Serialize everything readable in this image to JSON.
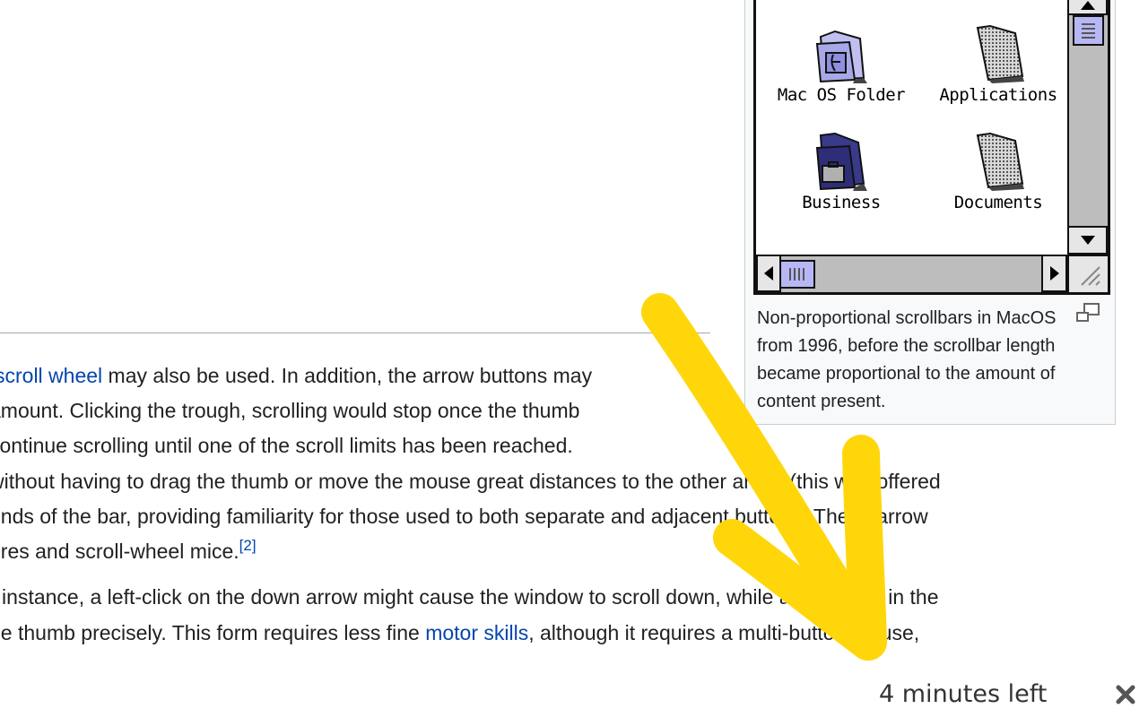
{
  "article": {
    "lines": [
      {
        "link": "scroll wheel",
        "text": " may also be used. In addition, the arrow buttons may"
      },
      {
        "text": "amount. Clicking the trough, scrolling would stop once the thumb"
      },
      {
        "text": "continue scrolling until one of the scroll limits has been reached."
      },
      {
        "text": "without having to drag the thumb or move the mouse great distances to the other arrow (this was offered"
      },
      {
        "text": "ends of the bar, providing familiarity for those used to both separate and adjacent buttons. These arrow"
      },
      {
        "text": "ures and scroll-wheel mice.",
        "sup": "[2]"
      },
      {
        "text": "r instance, a left-click on the down arrow might cause the window to scroll down, while a right click in the"
      },
      {
        "before": "he thumb precisely. This form requires less fine ",
        "link": "motor skills",
        "after": ", although it requires a multi-button mouse,"
      }
    ]
  },
  "thumbnail": {
    "icons": [
      {
        "label": "Mac OS Folder",
        "icon": "system-folder-icon"
      },
      {
        "label": "Applications",
        "icon": "folder-icon"
      },
      {
        "label": "Business",
        "icon": "business-folder-icon"
      },
      {
        "label": "Documents",
        "icon": "folder-icon"
      }
    ],
    "caption": "Non-proportional scrollbars in MacOS from 1996, before the scrollbar length became proportional to the amount of content present.",
    "enlarge_icon": "magnify-icon"
  },
  "download_bar": {
    "status": "4 minutes left",
    "close_icon": "close-icon"
  },
  "colors": {
    "link": "#0645ad",
    "overlay_arrow": "#ffd60a",
    "scroll_thumb": "#b7b7f5"
  }
}
